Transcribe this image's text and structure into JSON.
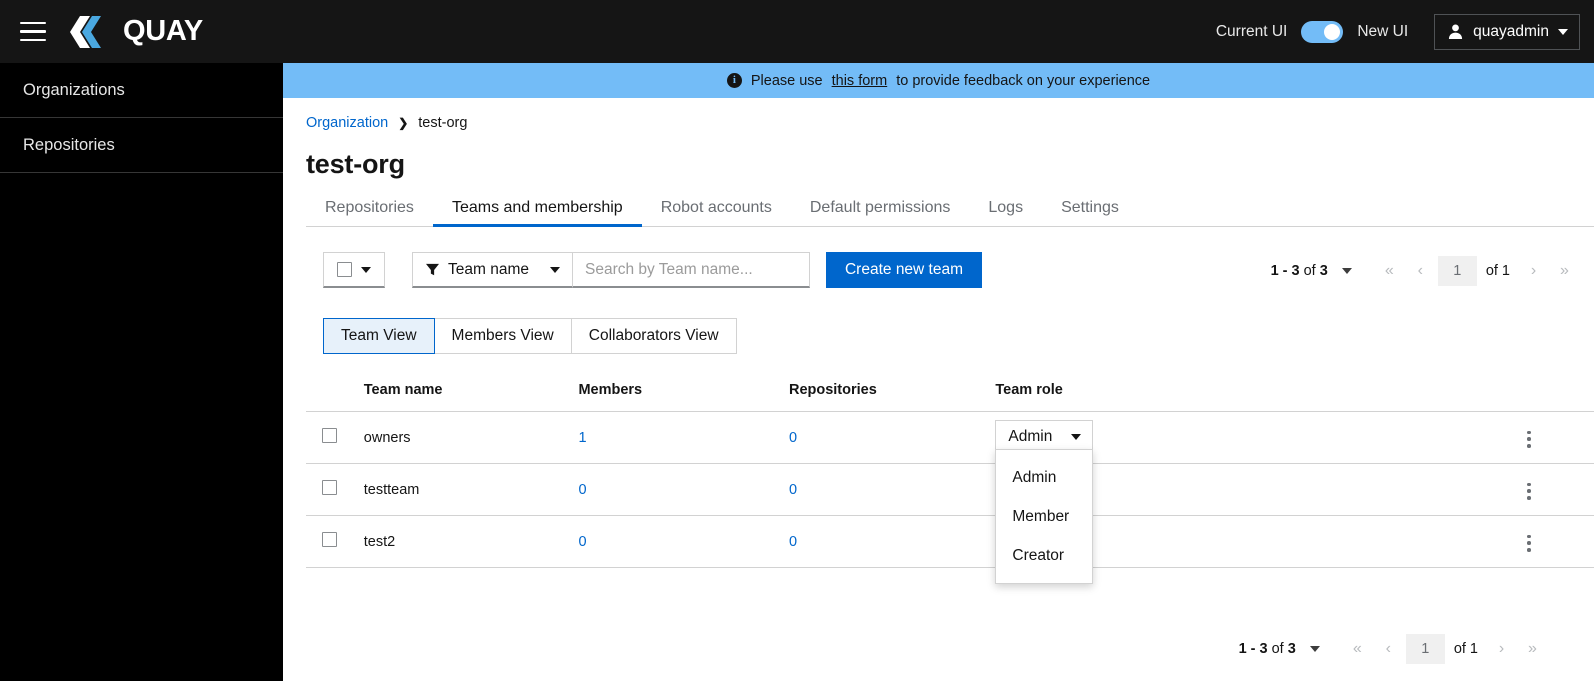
{
  "masthead": {
    "menu_icon": "hamburger-icon",
    "brand": "QUAY",
    "current_ui_label": "Current UI",
    "new_ui_label": "New UI",
    "toggle_state": "on",
    "user_icon": "user-avatar-icon",
    "username": "quayadmin"
  },
  "sidebar": {
    "items": [
      {
        "label": "Organizations"
      },
      {
        "label": "Repositories"
      }
    ]
  },
  "banner": {
    "icon": "info-circle-icon",
    "text_before": "Please use",
    "link_text": "this form",
    "text_after": "to provide feedback on your experience"
  },
  "breadcrumb": {
    "root": "Organization",
    "separator": "❯",
    "current": "test-org"
  },
  "page": {
    "title": "test-org"
  },
  "tabs": [
    {
      "label": "Repositories",
      "active": false
    },
    {
      "label": "Teams and membership",
      "active": true
    },
    {
      "label": "Robot accounts",
      "active": false
    },
    {
      "label": "Default permissions",
      "active": false
    },
    {
      "label": "Logs",
      "active": false
    },
    {
      "label": "Settings",
      "active": false
    }
  ],
  "toolbar": {
    "bulk_select_icon": "checkbox-icon",
    "bulk_select_caret": "chevron-down-icon",
    "filter_icon": "funnel-filter-icon",
    "filter_label": "Team name",
    "filter_caret": "chevron-down-icon",
    "search_placeholder": "Search by Team name...",
    "search_value": "",
    "create_label": "Create new team"
  },
  "pagination_top": {
    "summary_range": "1 - 3",
    "summary_of": "of",
    "summary_total": "3",
    "first_icon": "«",
    "prev_icon": "‹",
    "page_value": "1",
    "of_pages": "of 1",
    "next_icon": "›",
    "last_icon": "»"
  },
  "pagination_bottom": {
    "summary_range": "1 - 3",
    "summary_of": "of",
    "summary_total": "3",
    "first_icon": "«",
    "prev_icon": "‹",
    "page_value": "1",
    "of_pages": "of 1",
    "next_icon": "›",
    "last_icon": "»"
  },
  "view_toggle": [
    {
      "label": "Team View",
      "active": true
    },
    {
      "label": "Members View",
      "active": false
    },
    {
      "label": "Collaborators View",
      "active": false
    }
  ],
  "table": {
    "headers": {
      "team_name": "Team name",
      "members": "Members",
      "repositories": "Repositories",
      "team_role": "Team role"
    },
    "rows": [
      {
        "name": "owners",
        "members": "1",
        "repositories": "0",
        "role": "Admin",
        "role_open": true
      },
      {
        "name": "testteam",
        "members": "0",
        "repositories": "0",
        "role": "Member",
        "role_open": false
      },
      {
        "name": "test2",
        "members": "0",
        "repositories": "0",
        "role": "Member",
        "role_open": false
      }
    ]
  },
  "role_menu": {
    "options": [
      {
        "label": "Admin"
      },
      {
        "label": "Member"
      },
      {
        "label": "Creator"
      }
    ]
  },
  "colors": {
    "masthead_bg": "#151515",
    "sidebar_bg": "#000000",
    "banner_bg": "#73bcf7",
    "accent_blue": "#0066cc",
    "link_blue": "#06c",
    "toggle_on": "#73bcf7",
    "active_tab_underline": "#0066cc"
  }
}
